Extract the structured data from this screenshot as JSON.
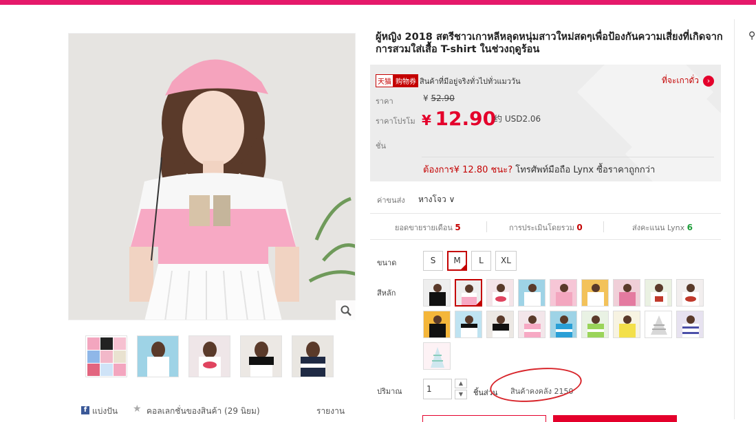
{
  "product": {
    "title": "ผู้หญิง 2018 สตรีชาวเกาหลีหลุดหนุ่มสาวใหม่สดๆเพื่อป้องกันความเสี่ยงที่เกิดจากการสวมใส่เสื้อ T-shirt ในช่วงฤดูร้อน"
  },
  "price_box": {
    "tmall_text": "天猫",
    "coupon_text": "购物券",
    "promo_note": "สินค้าที่มีอยู่จริงทั่วไปทั่วแมววัน",
    "where_link": "ที่จะเกาดั่ว",
    "price_label": "ราคา",
    "orig_price_symbol": "¥",
    "orig_price": "52.90",
    "promo_label_1": "ราคาโปรโม",
    "promo_label_2": "ชั่น",
    "promo_symbol": "¥",
    "promo_price": "12.90",
    "usd_text": "约 USD2.06",
    "want_red": "ต้องการ¥ 12.80 ชนะ?",
    "want_rest": " โทรศัพท์มือถือ Lynx ซื้อราคาถูกกว่า"
  },
  "shipping": {
    "label": "ค่าขนส่ง",
    "value": "หางโจว",
    "chevron": "∨"
  },
  "stats": {
    "monthly_sales_label": "ยอดขายรายเดือน",
    "monthly_sales": "5",
    "reviews_label": "การประเมินโดยรวม",
    "reviews": "0",
    "points_label": "ส่งคะแนน Lynx",
    "points": "6"
  },
  "size": {
    "label": "ขนาด",
    "options": [
      "S",
      "M",
      "L",
      "XL"
    ],
    "selected": "M"
  },
  "color": {
    "label": "สีหลัก",
    "selected_index": 1
  },
  "quantity": {
    "label": "ปริมาณ",
    "value": "1",
    "unit": "ชิ้นส่วน",
    "stock": "สินค้าคงคลัง 2150"
  },
  "share": {
    "share_text": "แบ่งปัน",
    "collect_text": "คอลเลกชั่นของสินค้า (29 นิยม)",
    "report_text": "รายงาน"
  },
  "icons": {
    "zoom": "magnifier-icon",
    "facebook": "facebook-icon",
    "star": "star-icon",
    "arrow": "arrow-right-icon"
  },
  "colors": {
    "accent": "#e4002b",
    "topbar": "#e5196a",
    "green": "#1e9e3a"
  }
}
